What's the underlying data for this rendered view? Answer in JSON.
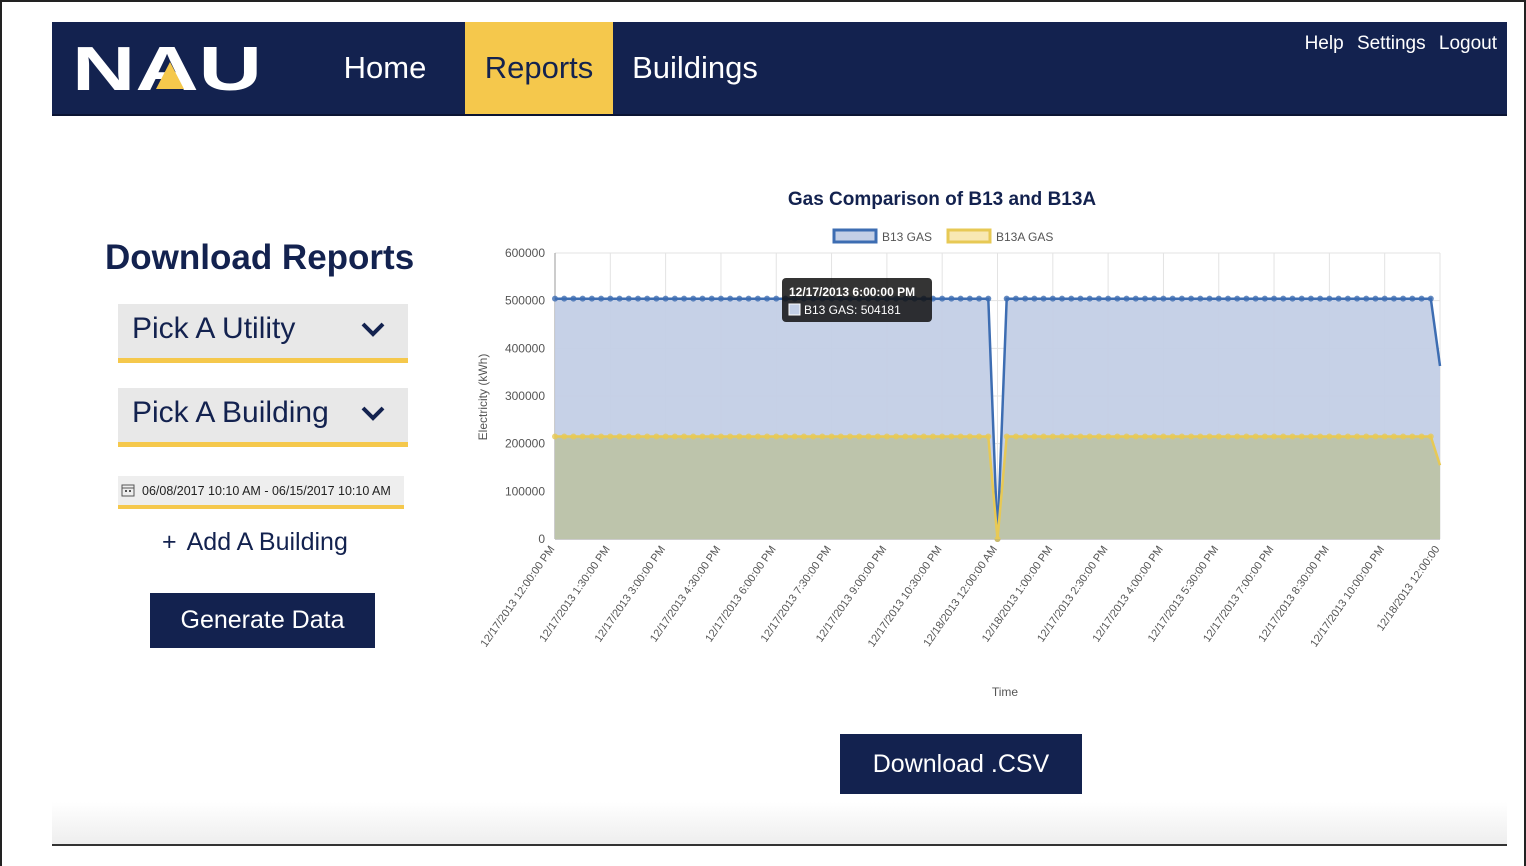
{
  "nav": {
    "logo_text": "NAU",
    "items": [
      {
        "label": "Home",
        "active": false
      },
      {
        "label": "Reports",
        "active": true
      },
      {
        "label": "Buildings",
        "active": false
      }
    ],
    "top_links": [
      "Help",
      "Settings",
      "Logout"
    ]
  },
  "sidebar": {
    "heading": "Download Reports",
    "utility_picker": "Pick A Utility",
    "building_picker": "Pick A Building",
    "date_range": "06/08/2017 10:10 AM - 06/15/2017 10:10 AM",
    "add_building": "Add A Building",
    "generate_button": "Generate Data"
  },
  "download_button": "Download .CSV",
  "colors": {
    "navy": "#13224f",
    "gold": "#f5c84c",
    "b13_line": "#3d6db2",
    "b13_fill": "#c3cfe6",
    "b13a_line": "#e7c955",
    "b13a_fill": "#bdc3a8"
  },
  "tooltip": {
    "title": "12/17/2013 6:00:00 PM",
    "body": "B13 GAS: 504181"
  },
  "chart_data": {
    "type": "area",
    "title": "Gas Comparison of B13 and B13A",
    "xlabel": "Time",
    "ylabel": "Electricity (kWh)",
    "ylim": [
      0,
      600000
    ],
    "yticks": [
      0,
      100000,
      200000,
      300000,
      400000,
      500000,
      600000
    ],
    "x_start": "12/17/2013 12:00:00 PM",
    "x_end": "12/18/2013 12:00:00 PM",
    "x_ticks": [
      "12/17/2013 12:00:00 PM",
      "12/17/2013 1:30:00 PM",
      "12/17/2013 3:00:00 PM",
      "12/17/2013 4:30:00 PM",
      "12/17/2013 6:00:00 PM",
      "12/17/2013 7:30:00 PM",
      "12/17/2013 9:00:00 PM",
      "12/17/2013 10:30:00 PM",
      "12/18/2013 12:00:00 AM",
      "12/18/2013 1:00:00 PM",
      "12/17/2013 2:30:00 PM",
      "12/17/2013 4:00:00 PM",
      "12/17/2013 5:30:00 PM",
      "12/17/2013 7:00:00 PM",
      "12/17/2013 8:30:00 PM",
      "12/17/2013 10:00:00 PM",
      "12/18/2013 12:00:00"
    ],
    "legend_position": "top",
    "grid": true,
    "dip_time": "12/18/2013 12:00:00 AM",
    "series": [
      {
        "name": "B13 GAS",
        "typical_value": 504181,
        "dip_value": 0
      },
      {
        "name": "B13A GAS",
        "typical_value": 215000,
        "dip_value": 0
      }
    ]
  }
}
